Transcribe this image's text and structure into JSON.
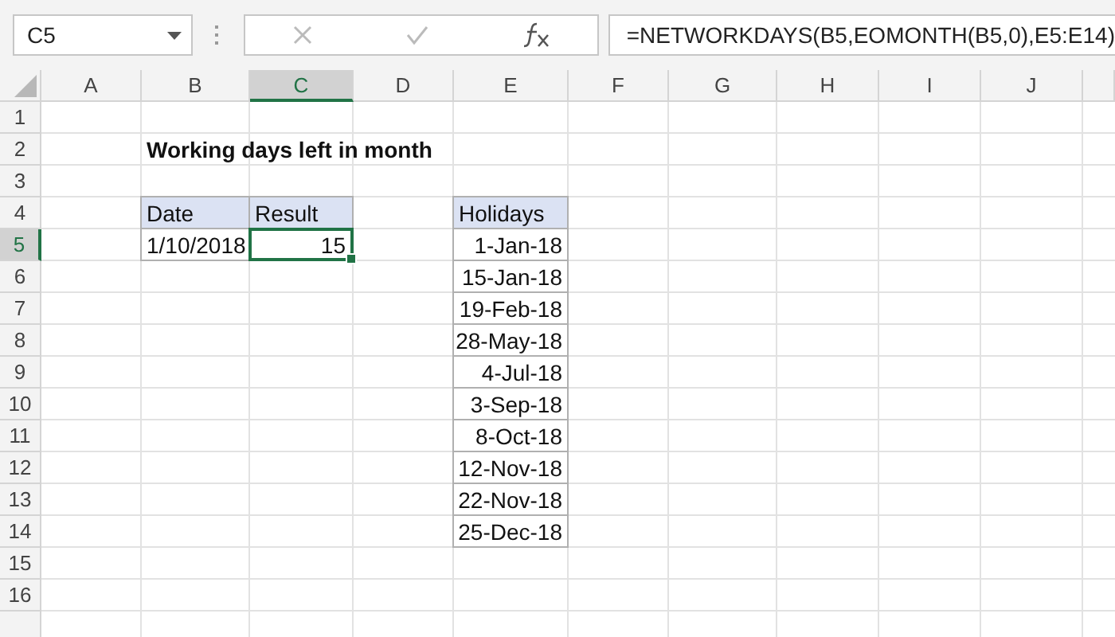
{
  "name_box": {
    "value": "C5"
  },
  "formula_bar": {
    "value": "=NETWORKDAYS(B5,EOMONTH(B5,0),E5:E14)"
  },
  "columns": [
    {
      "label": "A",
      "selected": false
    },
    {
      "label": "B",
      "selected": false
    },
    {
      "label": "C",
      "selected": true
    },
    {
      "label": "D",
      "selected": false
    },
    {
      "label": "E",
      "selected": false
    },
    {
      "label": "F",
      "selected": false
    },
    {
      "label": "G",
      "selected": false
    },
    {
      "label": "H",
      "selected": false
    },
    {
      "label": "I",
      "selected": false
    },
    {
      "label": "J",
      "selected": false
    }
  ],
  "rows": [
    {
      "label": "1",
      "selected": false
    },
    {
      "label": "2",
      "selected": false
    },
    {
      "label": "3",
      "selected": false
    },
    {
      "label": "4",
      "selected": false
    },
    {
      "label": "5",
      "selected": true
    },
    {
      "label": "6",
      "selected": false
    },
    {
      "label": "7",
      "selected": false
    },
    {
      "label": "8",
      "selected": false
    },
    {
      "label": "9",
      "selected": false
    },
    {
      "label": "10",
      "selected": false
    },
    {
      "label": "11",
      "selected": false
    },
    {
      "label": "12",
      "selected": false
    },
    {
      "label": "13",
      "selected": false
    },
    {
      "label": "14",
      "selected": false
    },
    {
      "label": "15",
      "selected": false
    },
    {
      "label": "16",
      "selected": false
    }
  ],
  "title": "Working days left in month",
  "date_table": {
    "columns": [
      "Date",
      "Result"
    ],
    "rows": [
      {
        "cells": [
          {
            "text": "1/10/2018",
            "selected": false
          },
          {
            "text": "15",
            "selected": true
          }
        ]
      }
    ]
  },
  "holidays_table": {
    "column": "Holidays",
    "rows": [
      "1-Jan-18",
      "15-Jan-18",
      "19-Feb-18",
      "28-May-18",
      "4-Jul-18",
      "3-Sep-18",
      "8-Oct-18",
      "12-Nov-18",
      "22-Nov-18",
      "25-Dec-18"
    ]
  }
}
